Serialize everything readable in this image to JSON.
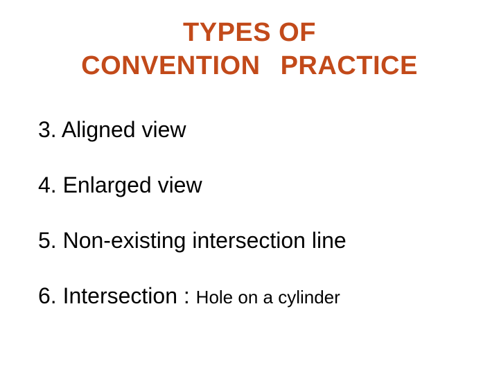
{
  "title": {
    "line1": "TYPES OF",
    "line2": "CONVENTION  PRACTICE"
  },
  "items": {
    "n3": "3. Aligned view",
    "n4": "4. Enlarged view",
    "n5": "5. Non-existing intersection line",
    "n6_main": "6. Intersection : ",
    "n6_sub": "Hole on a cylinder"
  }
}
